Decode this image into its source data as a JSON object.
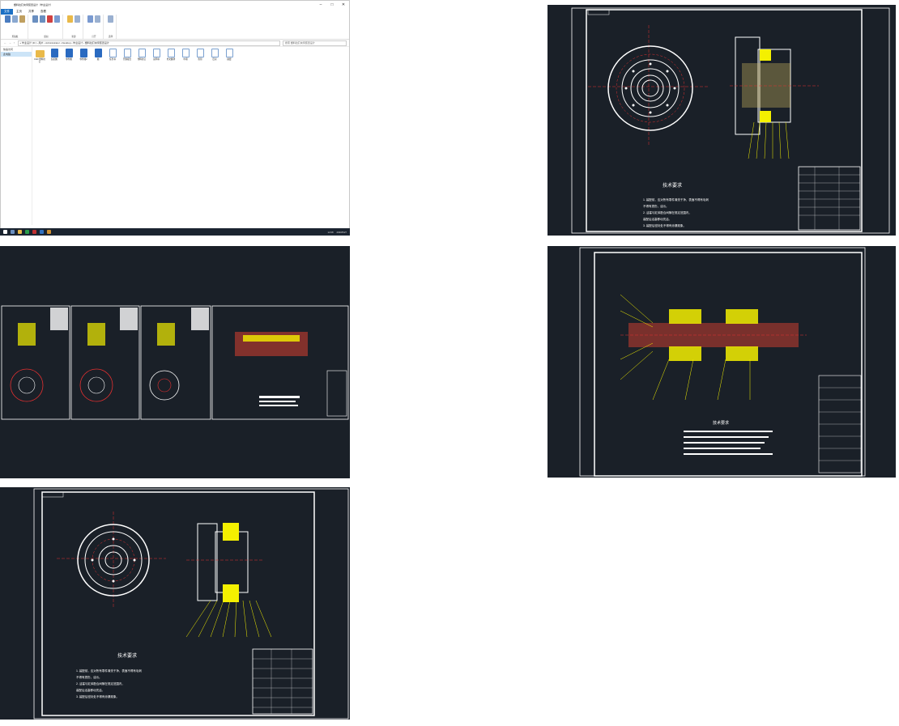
{
  "explorer": {
    "title": "塑料拉钉夹紧装置设计（毕业设计）",
    "tabs": [
      "文件",
      "主页",
      "共享",
      "查看"
    ],
    "ribbon_groups": [
      "剪贴板",
      "组织",
      "新建",
      "打开",
      "选择"
    ],
    "path": "« 毕业设计 (D:) › 用户 › Administrator › Desktop › 毕业设计 › 塑料拉钉夹紧装置设计",
    "search_placeholder": "搜索 塑料拉钉夹紧装置设计",
    "nav": [
      "快速访问",
      "此电脑"
    ],
    "files": [
      {
        "name": "CAD 塑料拉钉",
        "kind": "folder"
      },
      {
        "name": "装配图",
        "kind": "doc"
      },
      {
        "name": "零件图",
        "kind": "doc"
      },
      {
        "name": "零件图2",
        "kind": "doc"
      },
      {
        "name": "图",
        "kind": "doc"
      },
      {
        "name": "任务书",
        "kind": "txt"
      },
      {
        "name": "开题报告",
        "kind": "txt"
      },
      {
        "name": "塑料拉钉",
        "kind": "txt"
      },
      {
        "name": "说明书",
        "kind": "txt"
      },
      {
        "name": "外文翻译",
        "kind": "txt"
      },
      {
        "name": "中期",
        "kind": "txt"
      },
      {
        "name": "答辩",
        "kind": "txt"
      },
      {
        "name": "目录",
        "kind": "txt"
      },
      {
        "name": "摘要",
        "kind": "txt"
      }
    ],
    "clock_time": "12:08",
    "clock_date": "2020/5/27"
  },
  "cad_text": {
    "tech_title": "技术要求",
    "notes": [
      "1. 装配前，应对所有零件清洗干净，表面不得有毛刺",
      "不得有损伤，油污。",
      "2. 活塞与缸体配合间隙在规定范围内，",
      "装配后活塞移动灵活。",
      "3. 装配后密封处不得有渗漏现象。"
    ]
  },
  "colors": {
    "cad_bg": "#1a2028",
    "frame": "#ffffff",
    "yellow": "#f4f000",
    "red": "#e53030",
    "accent": "#1a6fc4"
  }
}
